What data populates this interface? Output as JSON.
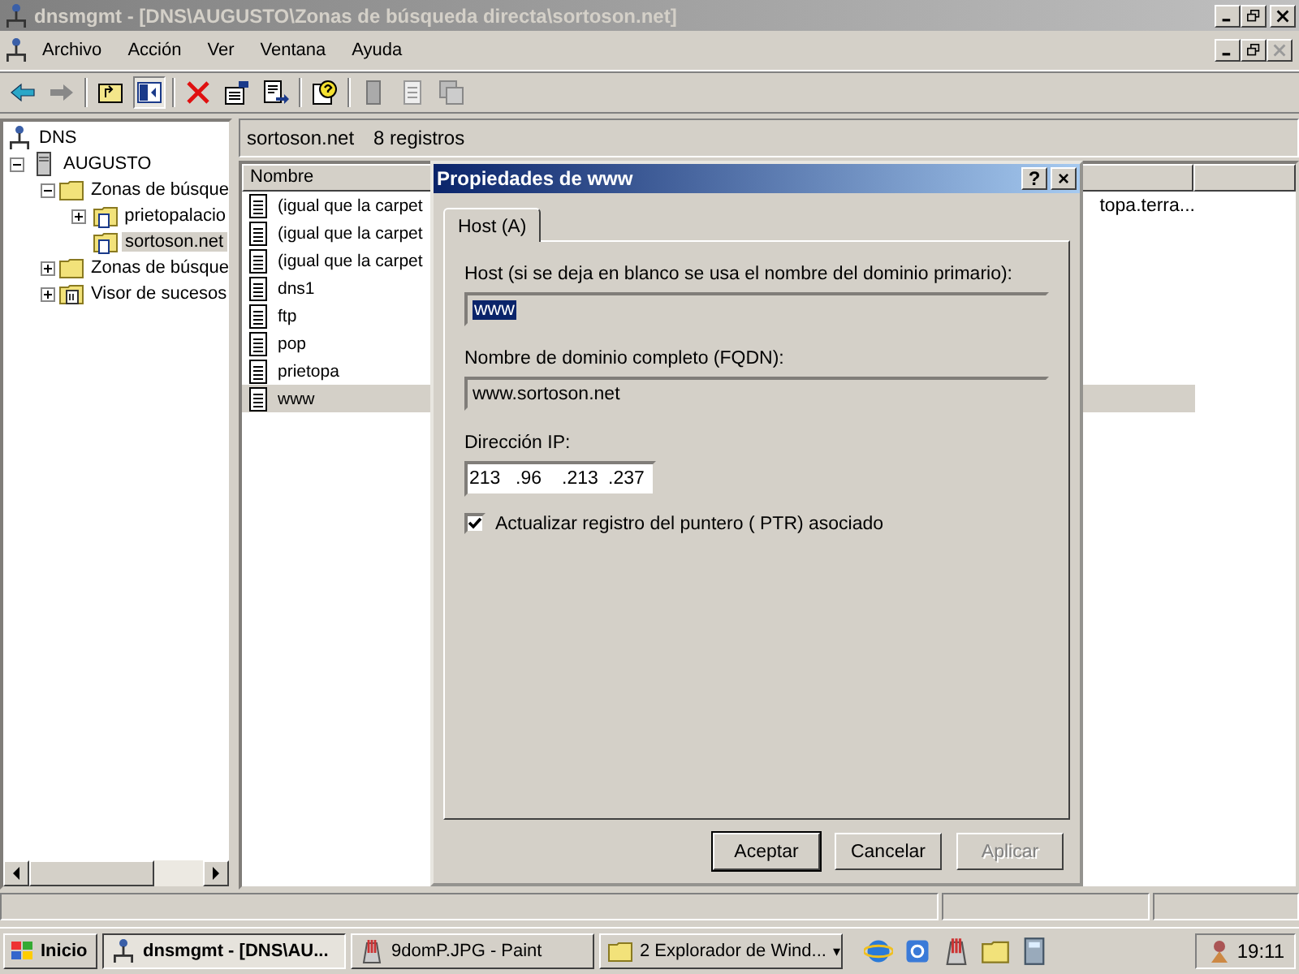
{
  "window": {
    "title": "dnsmgmt - [DNS\\AUGUSTO\\Zonas de búsqueda directa\\sortoson.net]"
  },
  "menu": [
    "Archivo",
    "Acción",
    "Ver",
    "Ventana",
    "Ayuda"
  ],
  "tree": [
    {
      "label": "DNS",
      "kind": "dns",
      "selected": false,
      "children": [
        {
          "label": "AUGUSTO",
          "kind": "server",
          "expanded": true,
          "selected": false,
          "children": [
            {
              "label": "Zonas de búsque",
              "kind": "folder",
              "expanded": true,
              "selected": false,
              "children": [
                {
                  "label": "prietopalacio",
                  "kind": "zone",
                  "expanded": false,
                  "selected": false
                },
                {
                  "label": "sortoson.net",
                  "kind": "zone",
                  "selected": true
                }
              ]
            },
            {
              "label": "Zonas de búsque",
              "kind": "folder",
              "expanded": false,
              "selected": false
            },
            {
              "label": "Visor de sucesos",
              "kind": "log",
              "expanded": false,
              "selected": false
            }
          ]
        }
      ]
    }
  ],
  "list": {
    "zone": "sortoson.net",
    "count": "8 registros",
    "columns": [
      "Nombre"
    ],
    "rows": [
      {
        "name": "(igual que la carpet",
        "data": "topa.terra...",
        "selected": false
      },
      {
        "name": "(igual que la carpet",
        "selected": false
      },
      {
        "name": "(igual que la carpet",
        "selected": false
      },
      {
        "name": "dns1",
        "selected": false
      },
      {
        "name": "ftp",
        "selected": false
      },
      {
        "name": "pop",
        "selected": false
      },
      {
        "name": "prietopa",
        "selected": false
      },
      {
        "name": "www",
        "selected": true
      }
    ]
  },
  "dialog": {
    "title": "Propiedades de www",
    "help": "?",
    "close": "×",
    "tabs": [
      {
        "label": "Host (A)",
        "selected": true
      }
    ],
    "host_label": "Host (si se deja en blanco se usa el nombre del dominio primario):",
    "host_value": "www",
    "fqdn_label": "Nombre de dominio completo (FQDN):",
    "fqdn_value": "www.sortoson.net",
    "ip_label": "Dirección IP:",
    "ip_octets": [
      "213",
      ".96",
      ".213",
      ".237"
    ],
    "ptr": {
      "label": "Actualizar registro del puntero ( PTR) asociado",
      "checked": true
    },
    "buttons": [
      {
        "label": "Aceptar",
        "disabled": false
      },
      {
        "label": "Cancelar",
        "disabled": false
      },
      {
        "label": "Aplicar",
        "disabled": true
      }
    ]
  },
  "taskbar": {
    "start": "Inicio",
    "tasks": [
      {
        "label": "dnsmgmt - [DNS\\AU...",
        "kind": "dns",
        "selected": true
      },
      {
        "label": "9domP.JPG - Paint",
        "kind": "paint",
        "selected": false
      },
      {
        "label": "2 Explorador de Wind...",
        "kind": "folder",
        "selected": false,
        "dropdown": "▾"
      }
    ],
    "clock": "19:11"
  }
}
